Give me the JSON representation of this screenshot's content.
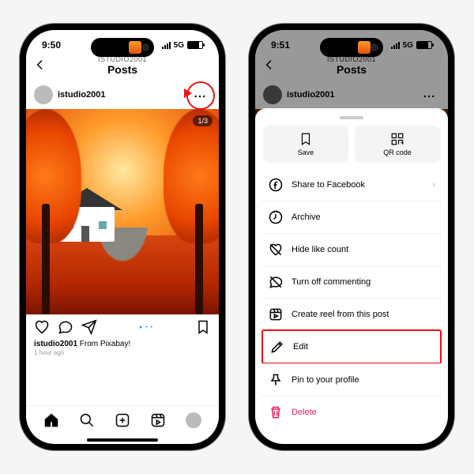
{
  "status": {
    "time_left": "9:50",
    "time_right": "9:51",
    "net": "5G"
  },
  "header": {
    "subtitle": "ISTUDIO2001",
    "title": "Posts"
  },
  "post": {
    "username": "istudio2001",
    "counter": "1/3",
    "caption_user": "istudio2001",
    "caption_text": " From Pixabay!",
    "time_ago": "1 hour ago"
  },
  "sheet": {
    "save": "Save",
    "qr": "QR code",
    "items": [
      {
        "icon": "facebook",
        "label": "Share to Facebook",
        "chevron": true
      },
      {
        "icon": "archive",
        "label": "Archive"
      },
      {
        "icon": "heart-off",
        "label": "Hide like count"
      },
      {
        "icon": "comment-off",
        "label": "Turn off commenting"
      },
      {
        "icon": "reel",
        "label": "Create reel from this post"
      },
      {
        "icon": "edit",
        "label": "Edit",
        "highlight": true
      },
      {
        "icon": "pin",
        "label": "Pin to your profile"
      },
      {
        "icon": "trash",
        "label": "Delete",
        "danger": true
      }
    ]
  }
}
